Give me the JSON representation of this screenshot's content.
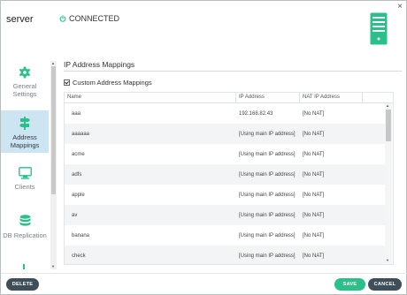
{
  "header": {
    "server_name": "server",
    "status": "CONNECTED",
    "close_symbol": "×"
  },
  "colors": {
    "accent": "#2bbf8a",
    "active_nav_bg": "#cde4f3",
    "dark_button": "#3f4f59"
  },
  "sidebar": {
    "items": [
      {
        "icon": "gear-icon",
        "label_line1": "General",
        "label_line2": "Settings",
        "active": false
      },
      {
        "icon": "signpost-icon",
        "label_line1": "Address",
        "label_line2": "Mappings",
        "active": true
      },
      {
        "icon": "monitor-icon",
        "label_line1": "Clients",
        "label_line2": "",
        "active": false
      },
      {
        "icon": "database-icon",
        "label_line1": "DB Replication",
        "label_line2": "",
        "active": false
      }
    ]
  },
  "section": {
    "title": "IP Address Mappings",
    "custom_checkbox_label": "Custom Address Mappings",
    "custom_checked": true
  },
  "table": {
    "columns": [
      "Name",
      "IP Address",
      "NAT IP Address"
    ],
    "rows": [
      {
        "name": "aaa",
        "ip": "192.168.82.43",
        "nat": "[No NAT]"
      },
      {
        "name": "aaaaaa",
        "ip": "[Using main IP address]",
        "nat": "[No NAT]"
      },
      {
        "name": "acme",
        "ip": "[Using main IP address]",
        "nat": "[No NAT]"
      },
      {
        "name": "adfs",
        "ip": "[Using main IP address]",
        "nat": "[No NAT]"
      },
      {
        "name": "apple",
        "ip": "[Using main IP address]",
        "nat": "[No NAT]"
      },
      {
        "name": "av",
        "ip": "[Using main IP address]",
        "nat": "[No NAT]"
      },
      {
        "name": "banana",
        "ip": "[Using main IP address]",
        "nat": "[No NAT]"
      },
      {
        "name": "check",
        "ip": "[Using main IP address]",
        "nat": "[No NAT]"
      }
    ]
  },
  "footer": {
    "delete_label": "DELETE",
    "save_label": "SAVE",
    "cancel_label": "CANCEL"
  }
}
